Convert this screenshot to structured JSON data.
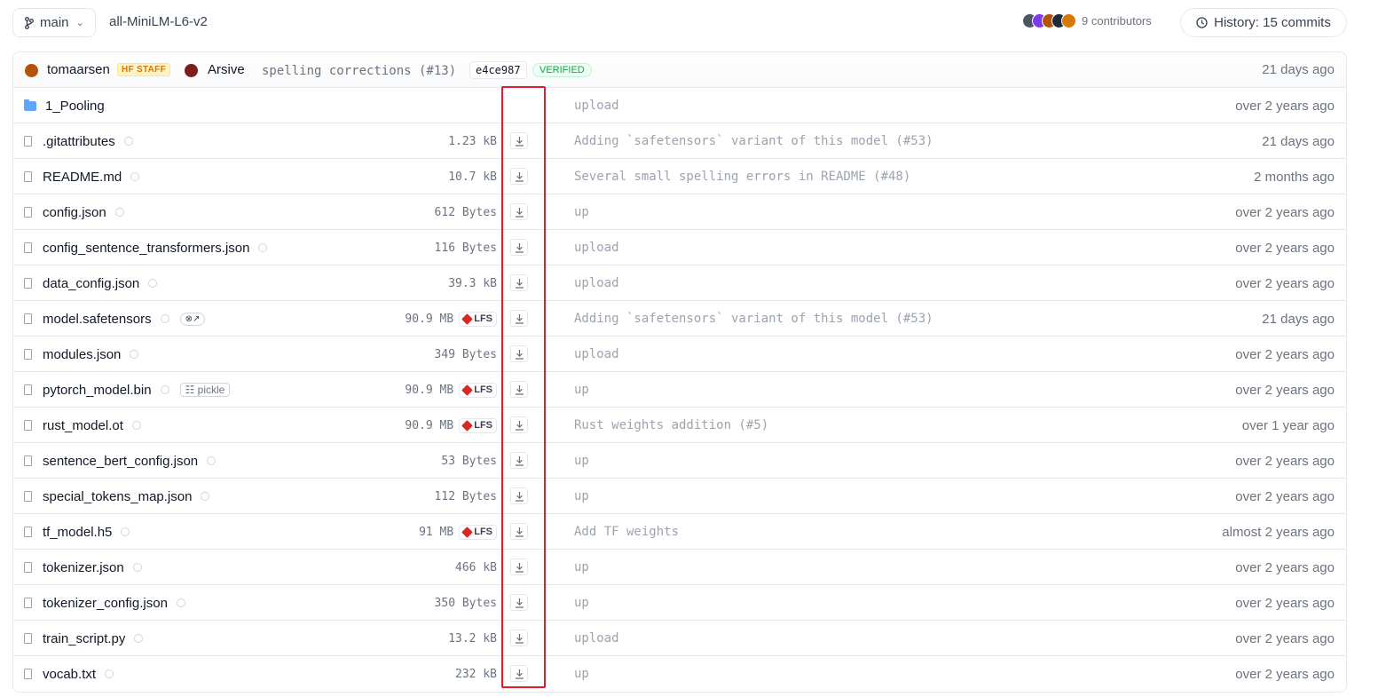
{
  "branch": {
    "label": "main"
  },
  "repo": {
    "name": "all-MiniLM-L6-v2"
  },
  "contributors": {
    "label": "9 contributors",
    "avatar_colors": [
      "#4b5563",
      "#7c3aed",
      "#b45309",
      "#1f2937",
      "#d97706"
    ]
  },
  "history": {
    "label": "History: 15 commits"
  },
  "commit": {
    "author": "tomaarsen",
    "author_badge": "HF STAFF",
    "coauthor": "Arsive",
    "message": "spelling corrections (#13)",
    "sha": "e4ce987",
    "verified": "VERIFIED",
    "date": "21 days ago"
  },
  "files": [
    {
      "name": "1_Pooling",
      "type": "folder",
      "size": "",
      "lfs": false,
      "extra": "",
      "message": "upload",
      "date": "over 2 years ago"
    },
    {
      "name": ".gitattributes",
      "type": "file",
      "size": "1.23 kB",
      "lfs": false,
      "extra": "",
      "message": "Adding `safetensors` variant of this model (#53)",
      "date": "21 days ago"
    },
    {
      "name": "README.md",
      "type": "file",
      "size": "10.7 kB",
      "lfs": false,
      "extra": "",
      "message": "Several small spelling errors in README (#48)",
      "date": "2 months ago"
    },
    {
      "name": "config.json",
      "type": "file",
      "size": "612 Bytes",
      "lfs": false,
      "extra": "",
      "message": "up",
      "date": "over 2 years ago"
    },
    {
      "name": "config_sentence_transformers.json",
      "type": "file",
      "size": "116 Bytes",
      "lfs": false,
      "extra": "",
      "message": "upload",
      "date": "over 2 years ago"
    },
    {
      "name": "data_config.json",
      "type": "file",
      "size": "39.3 kB",
      "lfs": false,
      "extra": "",
      "message": "upload",
      "date": "over 2 years ago"
    },
    {
      "name": "model.safetensors",
      "type": "file",
      "size": "90.9 MB",
      "lfs": true,
      "extra": "safetensors",
      "message": "Adding `safetensors` variant of this model (#53)",
      "date": "21 days ago"
    },
    {
      "name": "modules.json",
      "type": "file",
      "size": "349 Bytes",
      "lfs": false,
      "extra": "",
      "message": "upload",
      "date": "over 2 years ago"
    },
    {
      "name": "pytorch_model.bin",
      "type": "file",
      "size": "90.9 MB",
      "lfs": true,
      "extra": "pickle",
      "message": "up",
      "date": "over 2 years ago"
    },
    {
      "name": "rust_model.ot",
      "type": "file",
      "size": "90.9 MB",
      "lfs": true,
      "extra": "",
      "message": "Rust weights addition (#5)",
      "date": "over 1 year ago"
    },
    {
      "name": "sentence_bert_config.json",
      "type": "file",
      "size": "53 Bytes",
      "lfs": false,
      "extra": "",
      "message": "up",
      "date": "over 2 years ago"
    },
    {
      "name": "special_tokens_map.json",
      "type": "file",
      "size": "112 Bytes",
      "lfs": false,
      "extra": "",
      "message": "up",
      "date": "over 2 years ago"
    },
    {
      "name": "tf_model.h5",
      "type": "file",
      "size": "91 MB",
      "lfs": true,
      "extra": "",
      "message": "Add TF weights",
      "date": "almost 2 years ago"
    },
    {
      "name": "tokenizer.json",
      "type": "file",
      "size": "466 kB",
      "lfs": false,
      "extra": "",
      "message": "up",
      "date": "over 2 years ago"
    },
    {
      "name": "tokenizer_config.json",
      "type": "file",
      "size": "350 Bytes",
      "lfs": false,
      "extra": "",
      "message": "up",
      "date": "over 2 years ago"
    },
    {
      "name": "train_script.py",
      "type": "file",
      "size": "13.2 kB",
      "lfs": false,
      "extra": "",
      "message": "upload",
      "date": "over 2 years ago"
    },
    {
      "name": "vocab.txt",
      "type": "file",
      "size": "232 kB",
      "lfs": false,
      "extra": "",
      "message": "up",
      "date": "over 2 years ago"
    }
  ],
  "labels": {
    "lfs": "LFS",
    "pickle": "pickle"
  },
  "colors": {
    "highlight": "#e11d2a",
    "folder": "#60a5fa",
    "lfs_cube": "#dc2626"
  }
}
